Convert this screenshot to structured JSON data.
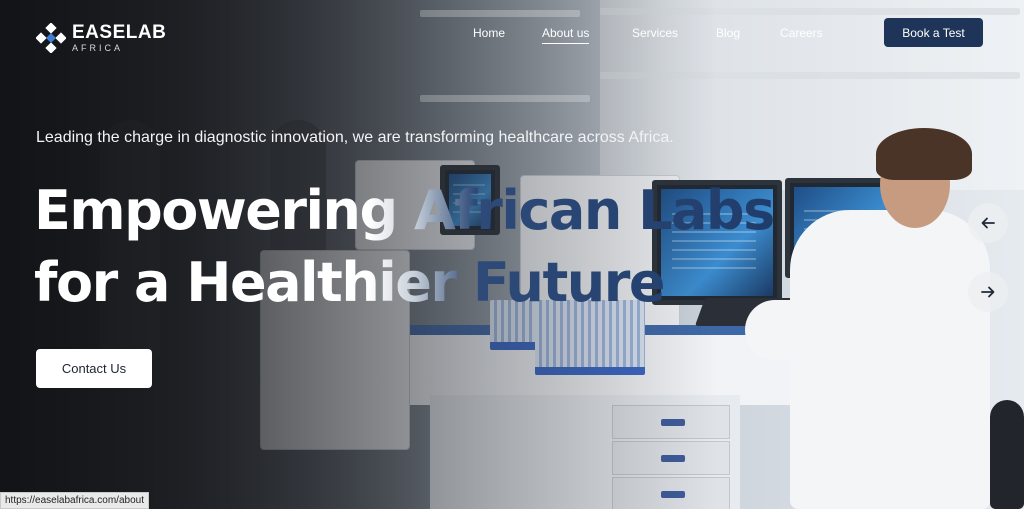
{
  "brand": {
    "name": "EASELAB",
    "sub": "AFRICA",
    "logo_icon": "diamond-cross-logo-icon"
  },
  "nav": {
    "items": [
      {
        "label": "Home"
      },
      {
        "label": "About us",
        "active": true
      },
      {
        "label": "Services"
      },
      {
        "label": "Blog"
      },
      {
        "label": "Careers"
      }
    ],
    "cta_label": "Book a Test"
  },
  "hero": {
    "tagline": "Leading the charge in diagnostic innovation, we are transforming healthcare across Africa.",
    "headline_line1": "Empowering African Labs",
    "headline_line2": "for a Healthier Future",
    "cta_label": "Contact Us",
    "prev_icon": "arrow-left-icon",
    "next_icon": "arrow-right-icon"
  },
  "status_bar": {
    "url": "https://easelabafrica.com/about"
  },
  "colors": {
    "primary": "#1e3458",
    "accent_blue": "#3f68a8",
    "text_light": "#ffffff"
  }
}
